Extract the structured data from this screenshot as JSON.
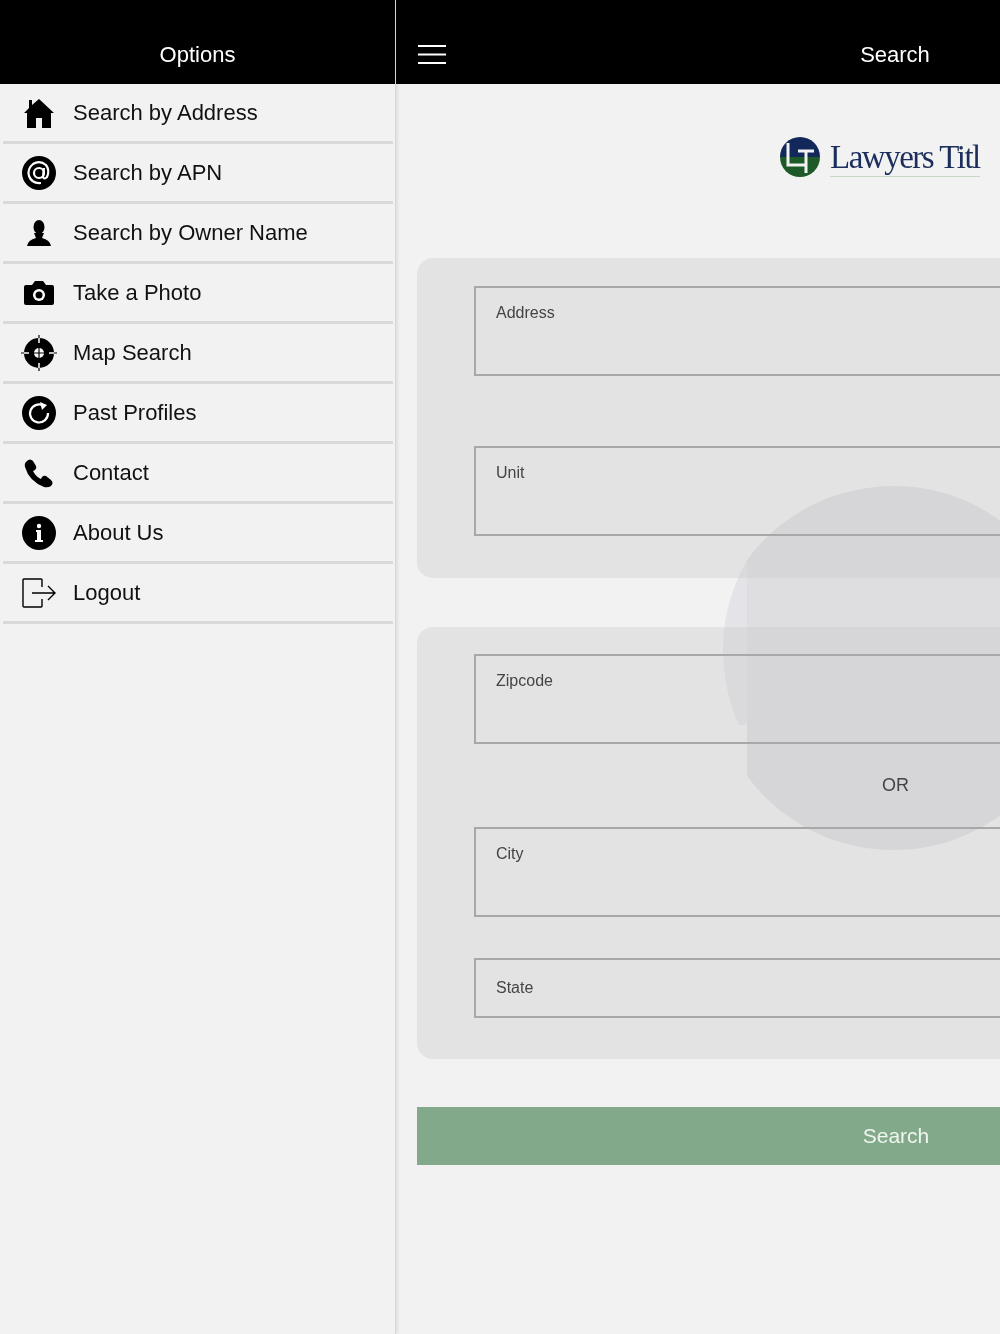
{
  "sidebar": {
    "title": "Options",
    "items": [
      {
        "label": "Search by Address"
      },
      {
        "label": "Search by APN"
      },
      {
        "label": "Search by Owner Name"
      },
      {
        "label": "Take a Photo"
      },
      {
        "label": "Map Search"
      },
      {
        "label": "Past Profiles"
      },
      {
        "label": "Contact"
      },
      {
        "label": "About Us"
      },
      {
        "label": "Logout"
      }
    ]
  },
  "main": {
    "title": "Search",
    "logo_text": "Lawyers Titl",
    "address_fields": [
      {
        "placeholder": "Address"
      },
      {
        "placeholder": "Unit"
      }
    ],
    "location_fields": [
      {
        "placeholder": "Zipcode"
      },
      {
        "placeholder": "City"
      },
      {
        "placeholder": "State"
      }
    ],
    "separator": "OR",
    "search_button": "Search"
  }
}
